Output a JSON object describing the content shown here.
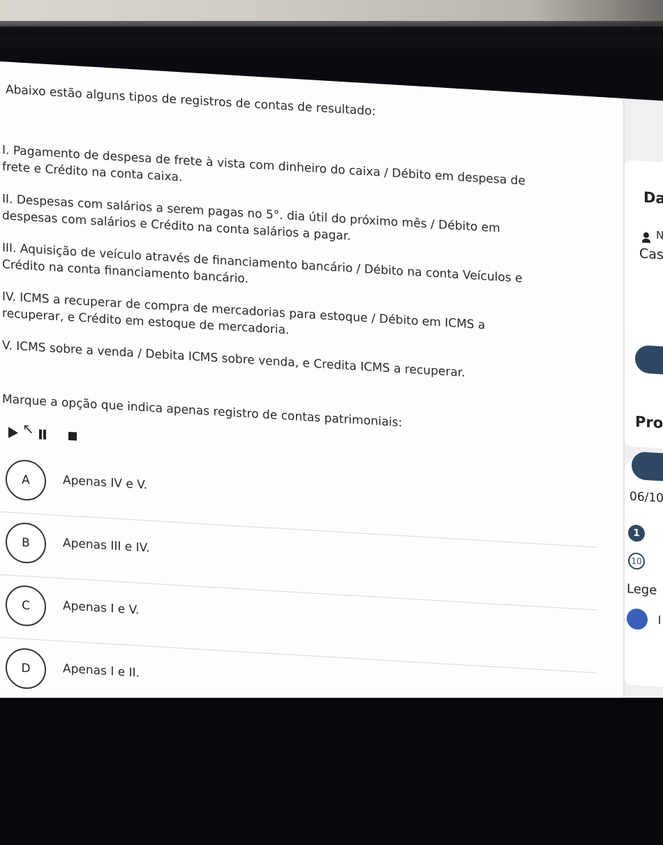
{
  "content": {
    "intro": "Abaixo estão alguns tipos de registros de contas de resultado:",
    "items": [
      {
        "line1": "I. Pagamento de despesa de frete à vista com dinheiro do caixa / Débito em despesa de",
        "line2": "frete e Crédito na conta caixa."
      },
      {
        "line1": "II. Despesas com salários a serem pagas no 5°. dia útil do próximo mês / Débito em",
        "line2": "despesas com salários e Crédito na conta salários a pagar."
      },
      {
        "line1": "III. Aquisição de veículo através de financiamento bancário / Débito na conta Veículos e",
        "line2": "Crédito na conta financiamento bancário."
      },
      {
        "line1": "IV. ICMS a recuperar de compra de mercadorias para estoque / Débito em ICMS a",
        "line2": "recuperar, e Crédito em estoque de mercadoria."
      },
      {
        "line1": "V. ICMS sobre a venda / Debita ICMS sobre venda, e Credita ICMS a recuperar.",
        "line2": ""
      }
    ],
    "question": "Marque a opção que indica apenas registro de contas patrimoniais:"
  },
  "media": {
    "play_icon": "play-icon",
    "pause_icon": "pause-icon",
    "stop_icon": "stop-icon"
  },
  "options": [
    {
      "letter": "A",
      "text": "Apenas IV e V."
    },
    {
      "letter": "B",
      "text": "Apenas III e IV."
    },
    {
      "letter": "C",
      "text": "Apenas I e V."
    },
    {
      "letter": "D",
      "text": "Apenas I e II."
    }
  ],
  "sidebar": {
    "title_fragment": "Da",
    "user_fragment": "N",
    "subtitle_fragment": "Cas",
    "section_fragment": "Pro",
    "progress": "06/10",
    "badge_current": "1",
    "badge_next": "10",
    "legend_fragment": "Lege"
  },
  "colors": {
    "accent": "#2f4864",
    "legend_blue": "#3a5fb8"
  }
}
